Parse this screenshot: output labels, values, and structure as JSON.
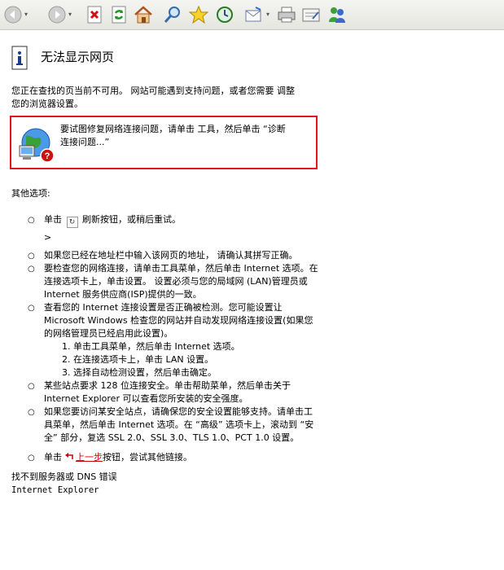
{
  "toolbar": {
    "icons": [
      "back-icon",
      "forward-icon",
      "stop-icon",
      "refresh-icon",
      "home-icon",
      "search-icon",
      "favorites-icon",
      "history-icon",
      "mail-icon",
      "print-icon",
      "edit-icon",
      "messenger-icon"
    ]
  },
  "page": {
    "title": "无法显示网页",
    "intro_line1": "您正在查找的页当前不可用。 网站可能遇到支持问题，或者您需要 调整",
    "intro_line2": "您的浏览器设置。",
    "diagnose_line1": "要试图修复网络连接问题，请单击 工具，然后单击 “诊断",
    "diagnose_line2": "连接问题...”",
    "other_options": "其他选项:",
    "option_refresh_pre": "单击",
    "option_refresh_post": "刷新按钮，或稍后重试。",
    "option_refresh_gt": ">",
    "option_address": "如果您已经在地址栏中输入该网页的地址， 请确认其拼写正确。",
    "option_network": "要检查您的网络连接，请单击工具菜单，然后单击 Internet 选项。在连接选项卡上，单击设置。 设置必须与您的局域网 (LAN)管理员或 Internet 服务供应商(ISP)提供的一致。",
    "option_detect": "查看您的 Internet 连接设置是否正确被检测。您可能设置让 Microsoft Windows 检查您的网站并自动发现网络连接设置(如果您的网络管理员已经启用此设置)。",
    "steps": [
      "单击工具菜单，然后单击 Internet 选项。",
      "在连接选项卡上，单击 LAN 设置。",
      "选择自动检测设置，然后单击确定。"
    ],
    "option_128": "某些站点要求 128 位连接安全。单击帮助菜单，然后单击关于 Internet Explorer 可以查看您所安装的安全强度。",
    "option_secure": "如果您要访问某安全站点，请确保您的安全设置能够支持。请单击工具菜单，然后单击 Internet 选项。在 “高级” 选项卡上，滚动到 “安全” 部分，复选 SSL 2.0、SSL 3.0、TLS 1.0、PCT 1.0 设置。",
    "option_back_pre": "单击",
    "option_back_link": "上一步",
    "option_back_post": "按钮，尝试其他链接。",
    "footer_line1": "找不到服务器或 DNS 错误",
    "footer_line2": "Internet Explorer"
  }
}
